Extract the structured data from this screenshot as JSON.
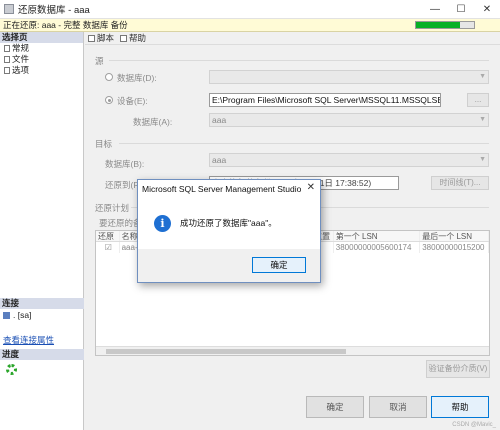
{
  "window": {
    "title": "还原数据库 - aaa",
    "controls": {
      "minimize": "—",
      "maximize": "☐",
      "close": "✕"
    }
  },
  "status": {
    "text": "正在还原: aaa - 完整 数据库 备份",
    "progress": 0.75,
    "progress_color": "#06b025"
  },
  "sidebar": {
    "pages_header": "选择页",
    "pages": [
      "常规",
      "文件",
      "选项"
    ],
    "connection_header": "连接",
    "server": ". [sa]",
    "view_connection_link": "查看连接属性",
    "progress_header": "进度"
  },
  "toolbar": {
    "script": "脚本",
    "help": "帮助"
  },
  "source": {
    "section": "源",
    "database_label": "数据库(D):",
    "device_label": "设备(E):",
    "device_path": "E:\\Program Files\\Microsoft SQL Server\\MSSQL11.MSSQLSERVER\\MS",
    "browse": "...",
    "database2_label": "数据库(A):",
    "database2_value": "aaa"
  },
  "target": {
    "section": "目标",
    "database_label": "数据库(B):",
    "database_value": "aaa",
    "restore_to_label": "还原到(R",
    "restore_to_value": "上次执行的备份(2023年7月31日 17:38:52)",
    "timeline_button": "时间线(T)..."
  },
  "restore_plan": {
    "section": "还原计划",
    "sets_label": "要还原的备",
    "columns": [
      "还原",
      "名称",
      "",
      "位置",
      "第一个 LSN",
      "最后一个 LSN"
    ],
    "rows": [
      {
        "restore": "☑",
        "name": "aaa-",
        "pos": "",
        "location": "",
        "first_lsn": "38000000005600174",
        "last_lsn": "38000000015200"
      }
    ],
    "verify_button": "验证备份介质(V)"
  },
  "buttons": {
    "ok": "确定",
    "cancel": "取消",
    "help": "帮助"
  },
  "watermark": "CSDN @Mavic_",
  "dialog": {
    "title": "Microsoft SQL Server Management Studio",
    "close": "✕",
    "icon": "info-icon",
    "icon_glyph": "i",
    "message": "成功还原了数据库\"aaa\"。",
    "ok": "确定"
  }
}
